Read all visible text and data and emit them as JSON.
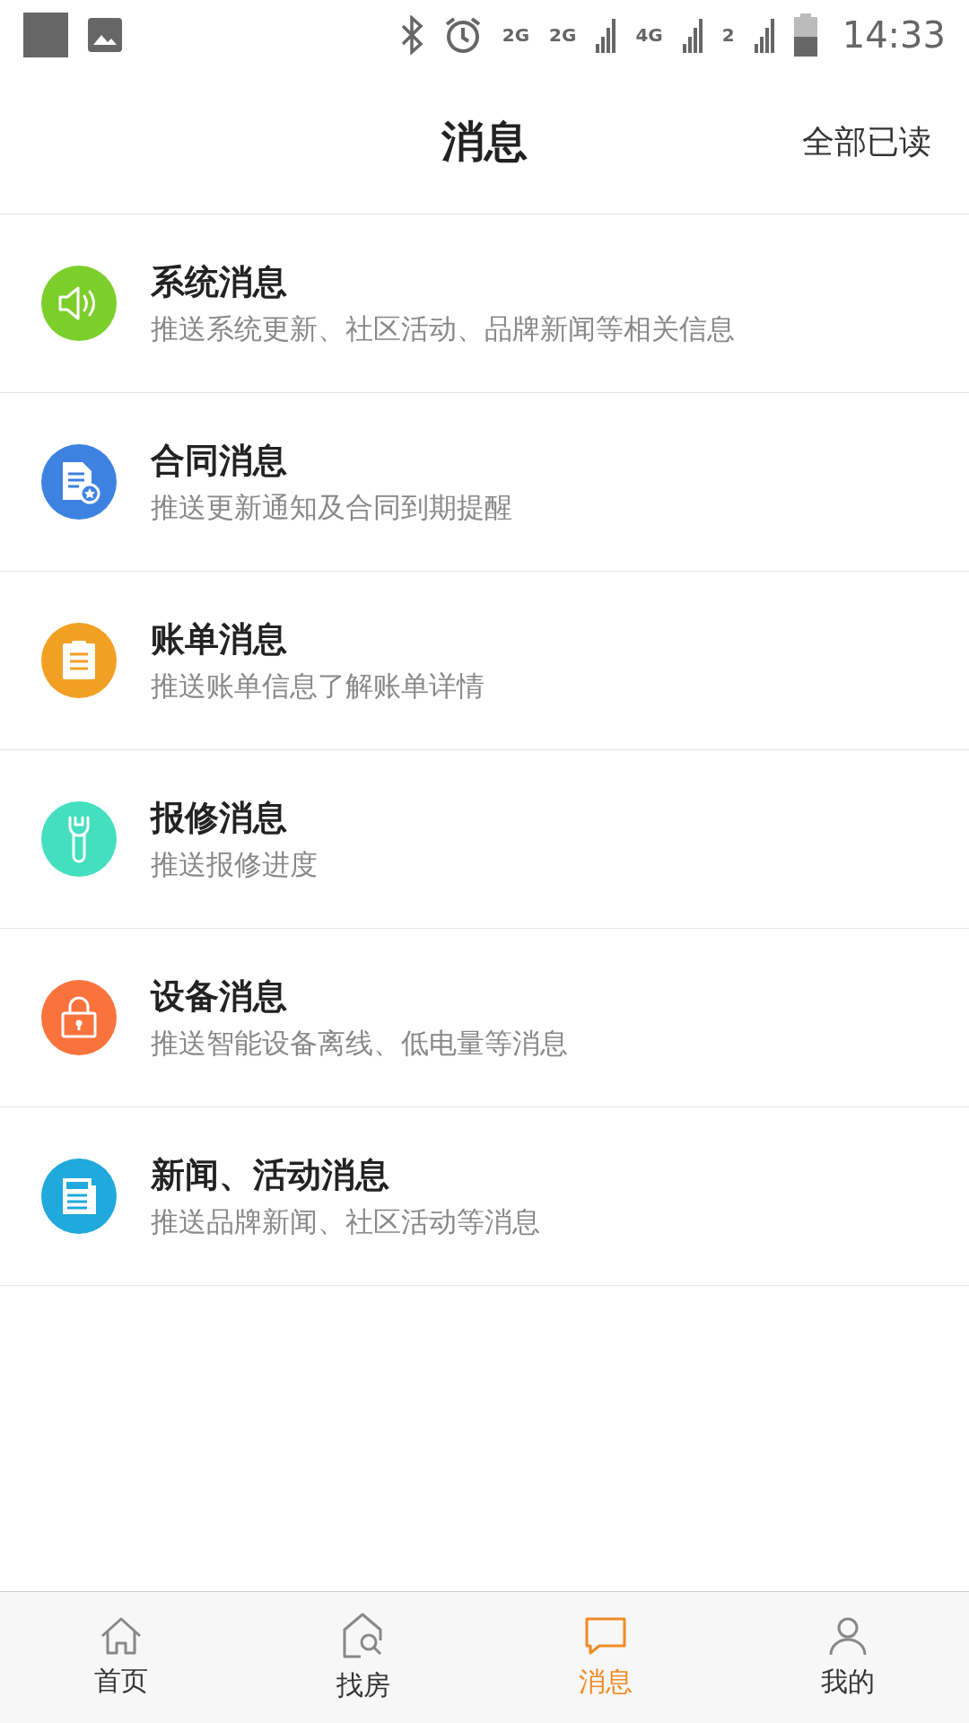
{
  "status_bar": {
    "time": "14:33",
    "network_labels": [
      "2G",
      "2G",
      "4G",
      "2"
    ]
  },
  "header": {
    "title": "消息",
    "action": "全部已读"
  },
  "messages": [
    {
      "kind": "speaker",
      "color": "#7ccf2b",
      "title": "系统消息",
      "subtitle": "推送系统更新、社区活动、品牌新闻等相关信息"
    },
    {
      "kind": "contract",
      "color": "#3d82e0",
      "title": "合同消息",
      "subtitle": "推送更新通知及合同到期提醒"
    },
    {
      "kind": "bill",
      "color": "#f2a024",
      "title": "账单消息",
      "subtitle": "推送账单信息了解账单详情"
    },
    {
      "kind": "repair",
      "color": "#43dfbe",
      "title": "报修消息",
      "subtitle": "推送报修进度"
    },
    {
      "kind": "device",
      "color": "#fa733d",
      "title": "设备消息",
      "subtitle": "推送智能设备离线、低电量等消息"
    },
    {
      "kind": "news",
      "color": "#1fa9dc",
      "title": "新闻、活动消息",
      "subtitle": "推送品牌新闻、社区活动等消息"
    }
  ],
  "tabs": [
    {
      "kind": "home",
      "label": "首页",
      "selected": false
    },
    {
      "kind": "search",
      "label": "找房",
      "selected": false
    },
    {
      "kind": "message",
      "label": "消息",
      "selected": true
    },
    {
      "kind": "user",
      "label": "我的",
      "selected": false
    }
  ]
}
